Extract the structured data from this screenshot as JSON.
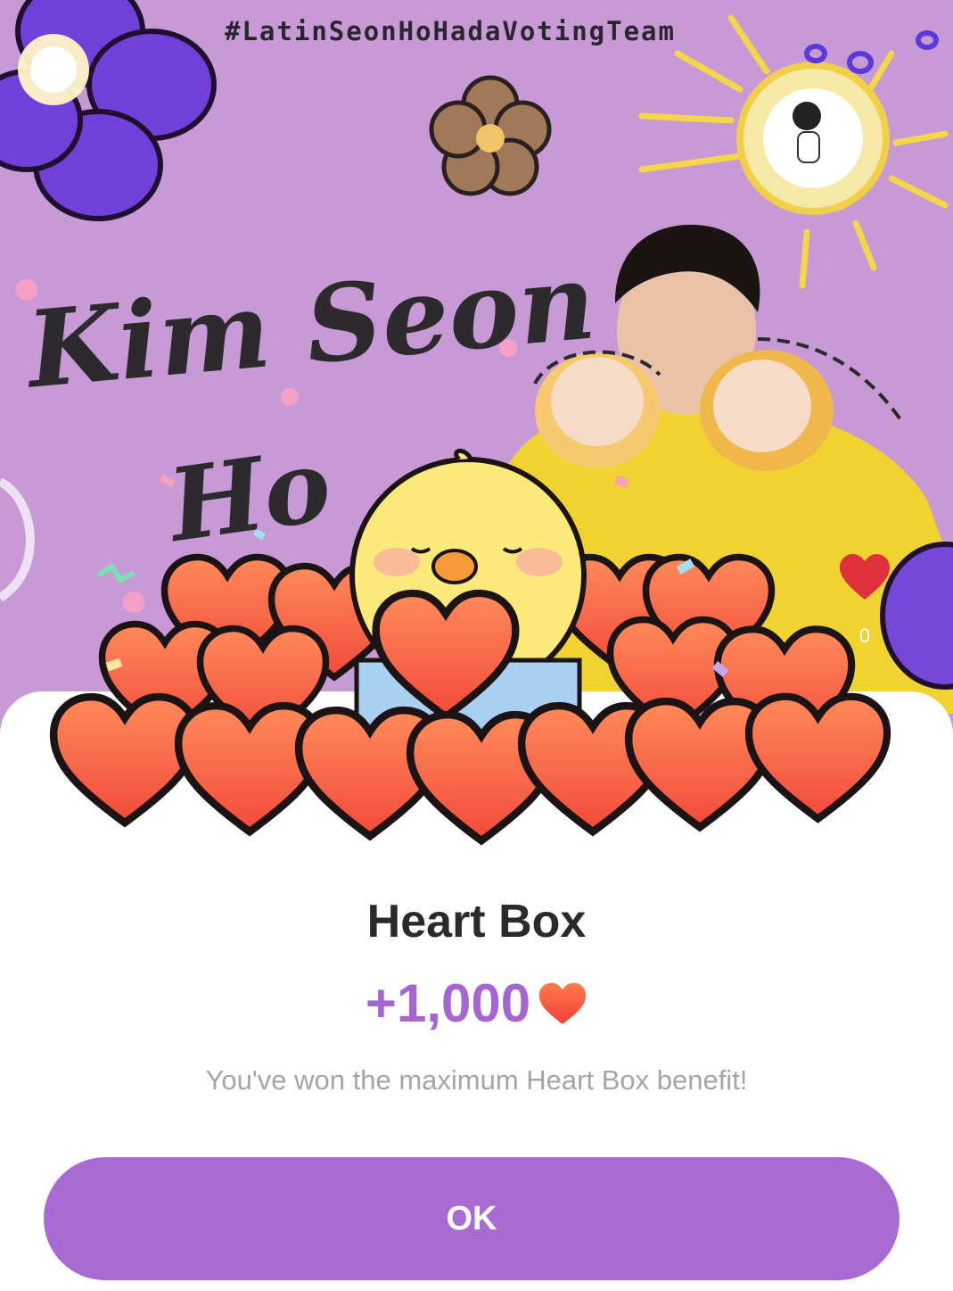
{
  "banner": {
    "hashtag": "#LatinSeonHoHadaVotingTeam",
    "name_line_1": "Kim Seon",
    "name_line_2": "Ho",
    "side_count": "0"
  },
  "dialog": {
    "title": "Heart Box",
    "amount": "+1,000",
    "message": "You've won the maximum Heart Box benefit!",
    "ok_label": "OK"
  },
  "colors": {
    "accent": "#a96bd3",
    "amount_text": "#a566d1",
    "heart": "#f0563d",
    "banner_bg": "#c79ad6"
  },
  "icons": [
    "heart-icon",
    "chick-mascot-icon",
    "sun-icon",
    "flower-icon",
    "team-logo-icon"
  ]
}
